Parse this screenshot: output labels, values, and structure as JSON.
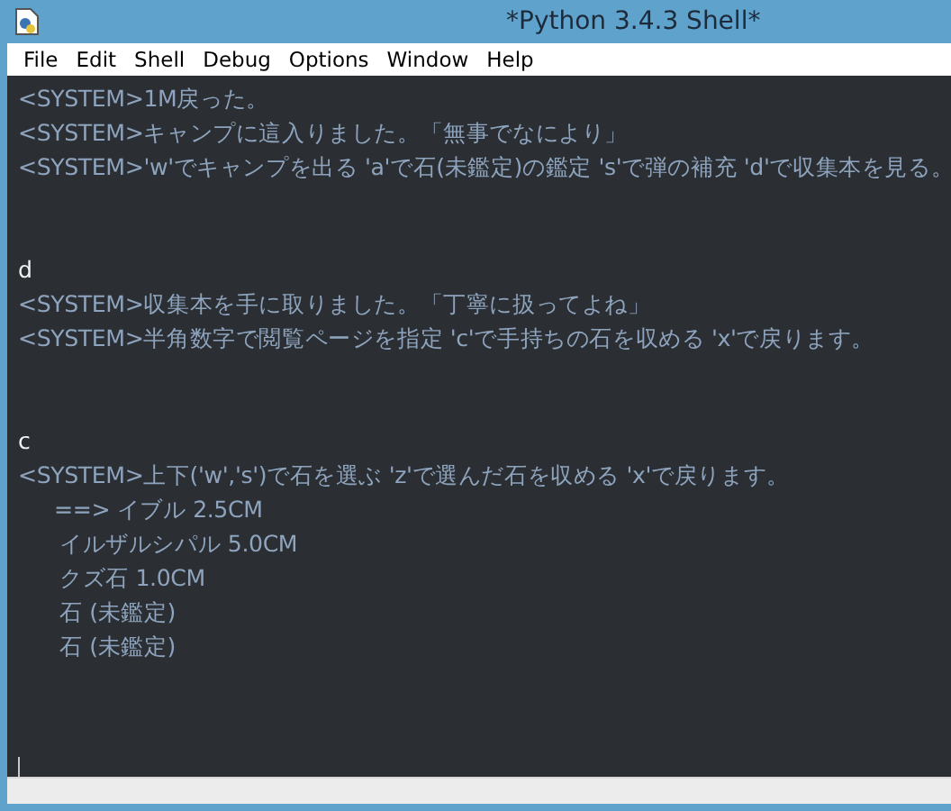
{
  "window": {
    "title": "*Python 3.4.3 Shell*"
  },
  "menu": [
    "File",
    "Edit",
    "Shell",
    "Debug",
    "Options",
    "Window",
    "Help"
  ],
  "lines": [
    {
      "kind": "output",
      "text": "<SYSTEM>1M戻った。"
    },
    {
      "kind": "output",
      "text": "<SYSTEM>キャンプに這入りました。「無事でなにより」"
    },
    {
      "kind": "output",
      "text": "<SYSTEM>'w'でキャンプを出る 'a'で石(未鑑定)の鑑定 's'で弾の補充 'd'で収集本を見る。"
    },
    {
      "kind": "blank"
    },
    {
      "kind": "blank"
    },
    {
      "kind": "input",
      "text": "d"
    },
    {
      "kind": "output",
      "text": "<SYSTEM>収集本を手に取りました。「丁寧に扱ってよね」"
    },
    {
      "kind": "output",
      "text": "<SYSTEM>半角数字で閲覧ページを指定 'c'で手持ちの石を収める 'x'で戻ります。"
    },
    {
      "kind": "blank"
    },
    {
      "kind": "blank"
    },
    {
      "kind": "input",
      "text": "c"
    },
    {
      "kind": "output",
      "text": "<SYSTEM>上下('w','s')で石を選ぶ 'z'で選んだ石を収める 'x'で戻ります。"
    },
    {
      "kind": "pointer",
      "text": "==> イブル 2.5CM"
    },
    {
      "kind": "item",
      "text": "イルザルシパル 5.0CM"
    },
    {
      "kind": "item",
      "text": "クズ石 1.0CM"
    },
    {
      "kind": "item",
      "text": "石 (未鑑定)"
    },
    {
      "kind": "item",
      "text": "石 (未鑑定)"
    }
  ]
}
